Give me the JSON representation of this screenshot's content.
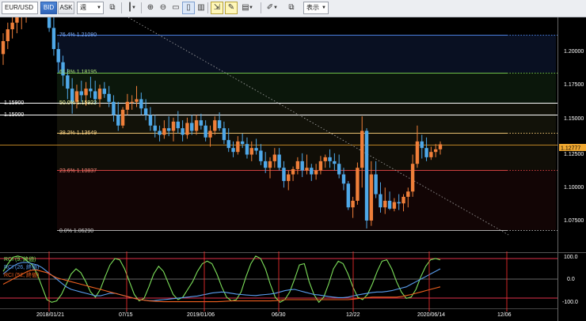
{
  "toolbar": {
    "symbol": "EUR/USD",
    "bid_label": "BID",
    "ask_label": "ASK",
    "period": "週",
    "display_label": "表示"
  },
  "fib_labels": [
    "76.4% 1.21080",
    "61.8% 1.18195",
    "50.0% 1.15922",
    "38.2% 1.13649",
    "23.6% 1.10837",
    "0.0% 1.06290"
  ],
  "left_labels": [
    "1.15900",
    "1.15000"
  ],
  "price_axis": [
    "1.20000",
    "1.17500",
    "1.15000",
    "1.12500",
    "1.10000",
    "1.07500"
  ],
  "current_price": "1.12777",
  "rci_axis": [
    "100.0",
    "0.0",
    "-100.0"
  ],
  "rci_legend": [
    "RCI (9, 終値)",
    "RCI (26, 終値)",
    "RCI (52, 終値)"
  ],
  "date_axis": [
    "2018/01/21",
    "07/15",
    "2019/01/06",
    "06/30",
    "12/22",
    "2020/06/14",
    "12/06"
  ],
  "colors": {
    "up": "#ef7f3a",
    "down": "#4fa8e8",
    "rci9": "#7de05a",
    "rci26": "#5a9ef0",
    "rci52": "#f0601e",
    "current": "#f0a830"
  },
  "chart_data": {
    "type": "candlestick",
    "timeframe": "weekly",
    "symbol": "EUR/USD",
    "price_range": [
      1.046,
      1.224
    ],
    "candles": [
      [
        1.1962,
        1.212,
        1.188,
        1.206
      ],
      [
        1.206,
        1.22,
        1.2,
        1.215
      ],
      [
        1.215,
        1.226,
        1.208,
        1.22
      ],
      [
        1.22,
        1.23,
        1.212,
        1.225
      ],
      [
        1.225,
        1.233,
        1.215,
        1.229
      ],
      [
        1.229,
        1.236,
        1.22,
        1.232
      ],
      [
        1.232,
        1.24,
        1.225,
        1.235
      ],
      [
        1.235,
        1.245,
        1.228,
        1.238
      ],
      [
        1.238,
        1.252,
        1.23,
        1.24
      ],
      [
        1.24,
        1.245,
        1.225,
        1.233
      ],
      [
        1.233,
        1.238,
        1.213,
        1.216
      ],
      [
        1.216,
        1.226,
        1.195,
        1.2
      ],
      [
        1.2,
        1.205,
        1.182,
        1.19
      ],
      [
        1.19,
        1.195,
        1.172,
        1.18
      ],
      [
        1.18,
        1.185,
        1.162,
        1.17
      ],
      [
        1.17,
        1.178,
        1.151,
        1.16
      ],
      [
        1.16,
        1.173,
        1.155,
        1.168
      ],
      [
        1.168,
        1.176,
        1.16,
        1.165
      ],
      [
        1.165,
        1.175,
        1.157,
        1.17
      ],
      [
        1.17,
        1.179,
        1.163,
        1.168
      ],
      [
        1.168,
        1.176,
        1.158,
        1.162
      ],
      [
        1.162,
        1.173,
        1.156,
        1.17
      ],
      [
        1.17,
        1.175,
        1.163,
        1.166
      ],
      [
        1.166,
        1.172,
        1.156,
        1.16
      ],
      [
        1.16,
        1.165,
        1.145,
        1.15
      ],
      [
        1.15,
        1.16,
        1.138,
        1.142
      ],
      [
        1.142,
        1.156,
        1.14,
        1.154
      ],
      [
        1.154,
        1.166,
        1.15,
        1.16
      ],
      [
        1.16,
        1.165,
        1.154,
        1.16
      ],
      [
        1.16,
        1.172,
        1.156,
        1.162
      ],
      [
        1.162,
        1.167,
        1.15,
        1.155
      ],
      [
        1.155,
        1.162,
        1.146,
        1.15
      ],
      [
        1.15,
        1.156,
        1.138,
        1.142
      ],
      [
        1.142,
        1.15,
        1.133,
        1.138
      ],
      [
        1.138,
        1.142,
        1.13,
        1.135
      ],
      [
        1.135,
        1.146,
        1.132,
        1.14
      ],
      [
        1.14,
        1.149,
        1.134,
        1.138
      ],
      [
        1.138,
        1.148,
        1.13,
        1.145
      ],
      [
        1.145,
        1.153,
        1.136,
        1.14
      ],
      [
        1.14,
        1.146,
        1.13,
        1.135
      ],
      [
        1.135,
        1.148,
        1.132,
        1.144
      ],
      [
        1.144,
        1.15,
        1.135,
        1.138
      ],
      [
        1.138,
        1.15,
        1.135,
        1.146
      ],
      [
        1.146,
        1.151,
        1.139,
        1.142
      ],
      [
        1.142,
        1.146,
        1.13,
        1.133
      ],
      [
        1.133,
        1.142,
        1.126,
        1.138
      ],
      [
        1.138,
        1.149,
        1.135,
        1.146
      ],
      [
        1.146,
        1.152,
        1.138,
        1.14
      ],
      [
        1.14,
        1.145,
        1.128,
        1.131
      ],
      [
        1.131,
        1.14,
        1.122,
        1.125
      ],
      [
        1.125,
        1.13,
        1.118,
        1.122
      ],
      [
        1.122,
        1.134,
        1.12,
        1.13
      ],
      [
        1.13,
        1.136,
        1.125,
        1.128
      ],
      [
        1.128,
        1.133,
        1.117,
        1.12
      ],
      [
        1.12,
        1.13,
        1.115,
        1.125
      ],
      [
        1.125,
        1.132,
        1.12,
        1.123
      ],
      [
        1.123,
        1.128,
        1.112,
        1.115
      ],
      [
        1.115,
        1.122,
        1.106,
        1.11
      ],
      [
        1.11,
        1.118,
        1.102,
        1.115
      ],
      [
        1.115,
        1.125,
        1.11,
        1.12
      ],
      [
        1.12,
        1.125,
        1.108,
        1.11
      ],
      [
        1.11,
        1.115,
        1.095,
        1.1
      ],
      [
        1.1,
        1.108,
        1.093,
        1.105
      ],
      [
        1.105,
        1.111,
        1.1,
        1.109
      ],
      [
        1.109,
        1.118,
        1.105,
        1.115
      ],
      [
        1.115,
        1.121,
        1.103,
        1.108
      ],
      [
        1.108,
        1.12,
        1.105,
        1.11
      ],
      [
        1.11,
        1.113,
        1.1,
        1.105
      ],
      [
        1.105,
        1.113,
        1.101,
        1.108
      ],
      [
        1.108,
        1.119,
        1.105,
        1.115
      ],
      [
        1.115,
        1.12,
        1.11,
        1.118
      ],
      [
        1.118,
        1.124,
        1.11,
        1.115
      ],
      [
        1.115,
        1.121,
        1.108,
        1.113
      ],
      [
        1.113,
        1.12,
        1.102,
        1.105
      ],
      [
        1.105,
        1.11,
        1.093,
        1.098
      ],
      [
        1.098,
        1.1,
        1.078,
        1.08
      ],
      [
        1.08,
        1.088,
        1.072,
        1.085
      ],
      [
        1.085,
        1.114,
        1.082,
        1.11
      ],
      [
        1.11,
        1.149,
        1.095,
        1.138
      ],
      [
        1.138,
        1.14,
        1.064,
        1.07
      ],
      [
        1.07,
        1.115,
        1.066,
        1.105
      ],
      [
        1.105,
        1.115,
        1.087,
        1.09
      ],
      [
        1.09,
        1.099,
        1.076,
        1.08
      ],
      [
        1.08,
        1.095,
        1.075,
        1.085
      ],
      [
        1.085,
        1.092,
        1.078,
        1.079
      ],
      [
        1.079,
        1.087,
        1.077,
        1.084
      ],
      [
        1.084,
        1.09,
        1.078,
        1.083
      ],
      [
        1.083,
        1.09,
        1.077,
        1.088
      ],
      [
        1.088,
        1.095,
        1.08,
        1.092
      ],
      [
        1.092,
        1.12,
        1.088,
        1.113
      ],
      [
        1.113,
        1.142,
        1.11,
        1.13
      ],
      [
        1.13,
        1.135,
        1.117,
        1.125
      ],
      [
        1.125,
        1.133,
        1.115,
        1.118
      ],
      [
        1.118,
        1.126,
        1.116,
        1.122
      ],
      [
        1.122,
        1.128,
        1.118,
        1.124
      ],
      [
        1.124,
        1.13,
        1.12,
        1.1278
      ]
    ],
    "fibonacci": [
      {
        "level": "76.4%",
        "price": 1.2108
      },
      {
        "level": "61.8%",
        "price": 1.18195
      },
      {
        "level": "50.0%",
        "price": 1.15922
      },
      {
        "level": "38.2%",
        "price": 1.13649
      },
      {
        "level": "23.6%",
        "price": 1.10837
      },
      {
        "level": "0.0%",
        "price": 1.0629
      }
    ],
    "horizontal_lines": [
      1.159,
      1.15
    ],
    "current_price": 1.12777,
    "rci": {
      "range": [
        -100,
        100
      ],
      "levels": [
        80,
        0,
        -80
      ],
      "series": [
        {
          "name": "RCI (9, 終値)",
          "values": [
            30,
            60,
            85,
            90,
            85,
            70,
            55,
            20,
            -30,
            -80,
            -90,
            -85,
            -60,
            -20,
            20,
            40,
            25,
            -10,
            -50,
            -70,
            -40,
            10,
            55,
            80,
            75,
            40,
            -10,
            -60,
            -85,
            -75,
            -30,
            20,
            50,
            30,
            -15,
            -60,
            -80,
            -70,
            -40,
            -10,
            30,
            60,
            70,
            60,
            20,
            -30,
            -70,
            -85,
            -80,
            -50,
            10,
            60,
            90,
            80,
            40,
            -20,
            -70,
            -90,
            -80,
            -50,
            0,
            55,
            60,
            -10,
            -60,
            -90,
            -70,
            -20,
            40,
            70,
            60,
            20,
            -30,
            -70,
            -80,
            -60,
            -20,
            30,
            70,
            75,
            40,
            -10,
            -50,
            -75,
            -70,
            -40,
            10,
            50,
            75,
            80,
            75
          ]
        },
        {
          "name": "RCI (26, 終値)",
          "values": [
            20,
            35,
            50,
            60,
            65,
            65,
            60,
            55,
            45,
            30,
            15,
            0,
            -15,
            -30,
            -40,
            -45,
            -50,
            -55,
            -60,
            -65,
            -65,
            -60,
            -55,
            -55,
            -60,
            -65,
            -70,
            -75,
            -80,
            -82,
            -84,
            -84,
            -82,
            -80,
            -78,
            -76,
            -74,
            -72,
            -70,
            -68,
            -66,
            -62,
            -58,
            -54,
            -52,
            -50,
            -52,
            -55,
            -58,
            -60,
            -62,
            -63,
            -64,
            -62,
            -60,
            -58,
            -55,
            -50,
            -45,
            -42,
            -40,
            -45,
            -50,
            -55,
            -60,
            -62,
            -65,
            -68,
            -70,
            -72,
            -72,
            -70,
            -66,
            -62,
            -58,
            -55,
            -52,
            -50,
            -50,
            -48,
            -45,
            -40,
            -35,
            -30,
            -20,
            -10,
            0,
            10,
            20,
            30,
            40
          ]
        },
        {
          "name": "RCI (52, 終値)",
          "values": [
            -20,
            -10,
            0,
            10,
            20,
            30,
            35,
            35,
            30,
            25,
            15,
            5,
            0,
            -5,
            -10,
            -15,
            -20,
            -25,
            -30,
            -35,
            -40,
            -45,
            -50,
            -55,
            -60,
            -65,
            -70,
            -75,
            -80,
            -82,
            -85,
            -86,
            -87,
            -88,
            -88,
            -88,
            -88,
            -88,
            -88,
            -88,
            -88,
            -88,
            -88,
            -88,
            -88,
            -87,
            -86,
            -85,
            -85,
            -85,
            -85,
            -85,
            -85,
            -85,
            -85,
            -85,
            -84,
            -82,
            -80,
            -80,
            -80,
            -80,
            -80,
            -80,
            -80,
            -80,
            -80,
            -80,
            -80,
            -80,
            -80,
            -80,
            -78,
            -76,
            -74,
            -72,
            -70,
            -70,
            -70,
            -70,
            -70,
            -70,
            -68,
            -64,
            -60,
            -55,
            -50,
            -45,
            -40,
            -35,
            -30
          ]
        }
      ]
    },
    "x_tick_labels": [
      "2018/01/21",
      "07/15",
      "2019/01/06",
      "06/30",
      "12/22",
      "2020/06/14",
      "12/06"
    ]
  }
}
